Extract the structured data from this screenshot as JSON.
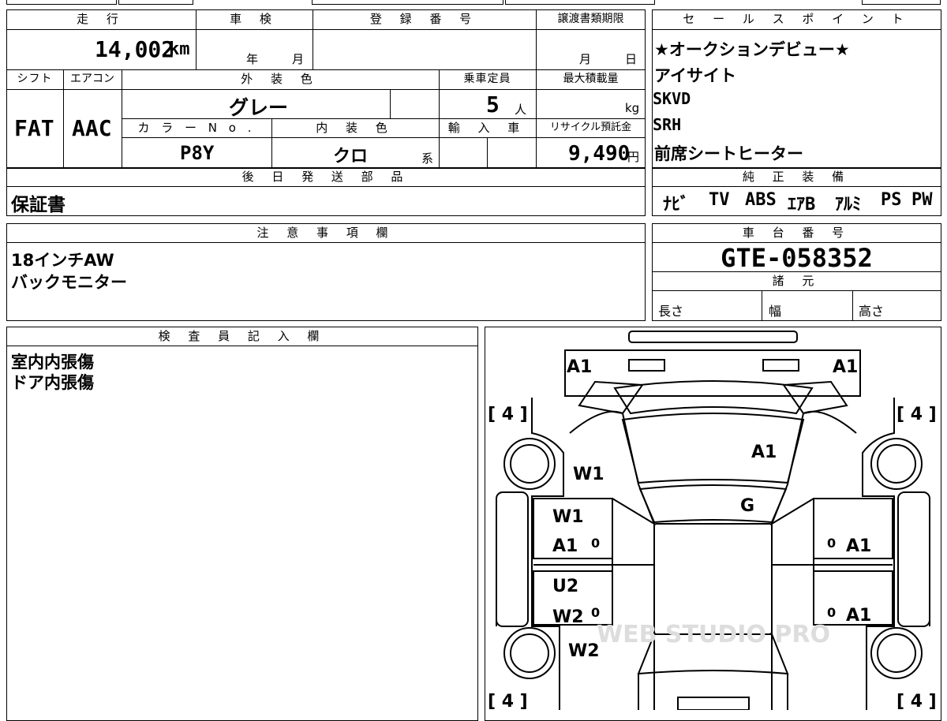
{
  "headers": {
    "mileage": "走 行",
    "inspection": "車 検",
    "registration": "登 録 番 号",
    "transfer_deadline": "譲渡書類期限",
    "shift": "シフト",
    "aircon": "エアコン",
    "exterior_color": "外 装 色",
    "capacity": "乗車定員",
    "max_load": "最大積載量",
    "color_no": "カ ラ ー N o .",
    "interior_color": "内 装 色",
    "import": "輸 入 車",
    "recycle": "リサイクル預託金",
    "later_parts": "後 日 発 送 部 品",
    "sales_points": "セ ー ル ス ポ イ ン ト",
    "genuine_equipment": "純 正 装 備",
    "notes": "注 意 事 項 欄",
    "chassis_no": "車 台 番 号",
    "specs": "諸 元",
    "inspector": "検 査 員 記 入 欄"
  },
  "vehicle": {
    "mileage_value": "14,002",
    "mileage_unit": "km",
    "inspection_year": "年",
    "inspection_month": "月",
    "deadline_month": "月",
    "deadline_day": "日",
    "shift": "FAT",
    "aircon": "AAC",
    "exterior_color": "グレー",
    "capacity_value": "5",
    "capacity_unit": "人",
    "load_unit": "kg",
    "color_no": "P8Y",
    "interior_color": "クロ",
    "interior_suffix": "系",
    "recycle_value": "9,490",
    "recycle_unit": "円",
    "later_parts": "保証書",
    "chassis_no": "GTE-058352",
    "length_label": "長さ",
    "width_label": "幅",
    "height_label": "高さ"
  },
  "sales_points": [
    "★オークションデビュー★",
    "アイサイト",
    "SKVD",
    "SRH",
    "前席シートヒーター"
  ],
  "equipment": [
    "ﾅﾋﾞ",
    "TV",
    "ABS",
    "ｴｱB",
    "ｱﾙﾐ",
    "PS",
    "PW"
  ],
  "notes_lines": [
    "18インチAW",
    "バックモニター"
  ],
  "inspector_lines": [
    "室内内張傷",
    "ドア内張傷"
  ],
  "diagram": {
    "tire_fl": "[ 4 ]",
    "tire_fr": "[ 4 ]",
    "tire_rl": "[ 4 ]",
    "tire_rr": "[ 4 ]",
    "front_left": "A1",
    "front_right": "A1",
    "hood": "A1",
    "windshield": "G",
    "left_fender": "W1",
    "left_door_front_1": "W1",
    "left_door_front_2": "A1",
    "left_door_rear_1": "U2",
    "left_door_rear_2": "W2",
    "left_rear_fender": "W2",
    "right_door_front": "A1",
    "right_door_rear": "A1",
    "mark_0": "0",
    "watermark": "WEB STUDIO PRO"
  }
}
